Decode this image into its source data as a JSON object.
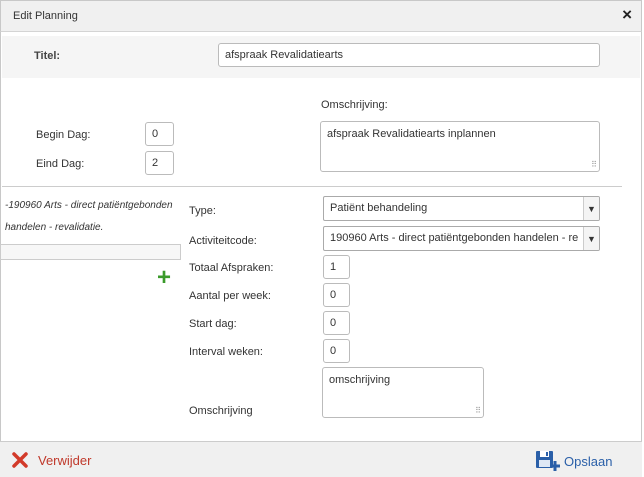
{
  "dialog": {
    "title": "Edit Planning",
    "close_icon": "close-icon"
  },
  "header": {
    "title_label": "Titel:",
    "title_value": "afspraak Revalidatiearts"
  },
  "days": {
    "begin_label": "Begin Dag:",
    "begin_value": "0",
    "end_label": "Eind Dag:",
    "end_value": "2",
    "description_label": "Omschrijving:",
    "description_value": "afspraak Revalidatiearts inplannen"
  },
  "activity_panel": {
    "selected_text": "-190960 Arts - direct patiëntgebonden handelen - revalidatie.",
    "add_icon": "plus-icon"
  },
  "activity_form": {
    "type_label": "Type:",
    "type_value": "Patiënt behandeling",
    "code_label": "Activiteitcode:",
    "code_value": "190960 Arts - direct patiëntgebonden handelen - re",
    "total_label": "Totaal Afspraken:",
    "total_value": "1",
    "per_week_label": "Aantal per week:",
    "per_week_value": "0",
    "start_label": "Start dag:",
    "start_value": "0",
    "interval_label": "Interval weken:",
    "interval_value": "0",
    "description_label": "Omschrijving",
    "description_value": "omschrijving"
  },
  "footer": {
    "delete_label": "Verwijder",
    "delete_icon": "delete-x-icon",
    "delete_color": "#c0392b",
    "save_label": "Opslaan",
    "save_icon": "save-disk-icon",
    "save_color": "#2a5fa8"
  }
}
